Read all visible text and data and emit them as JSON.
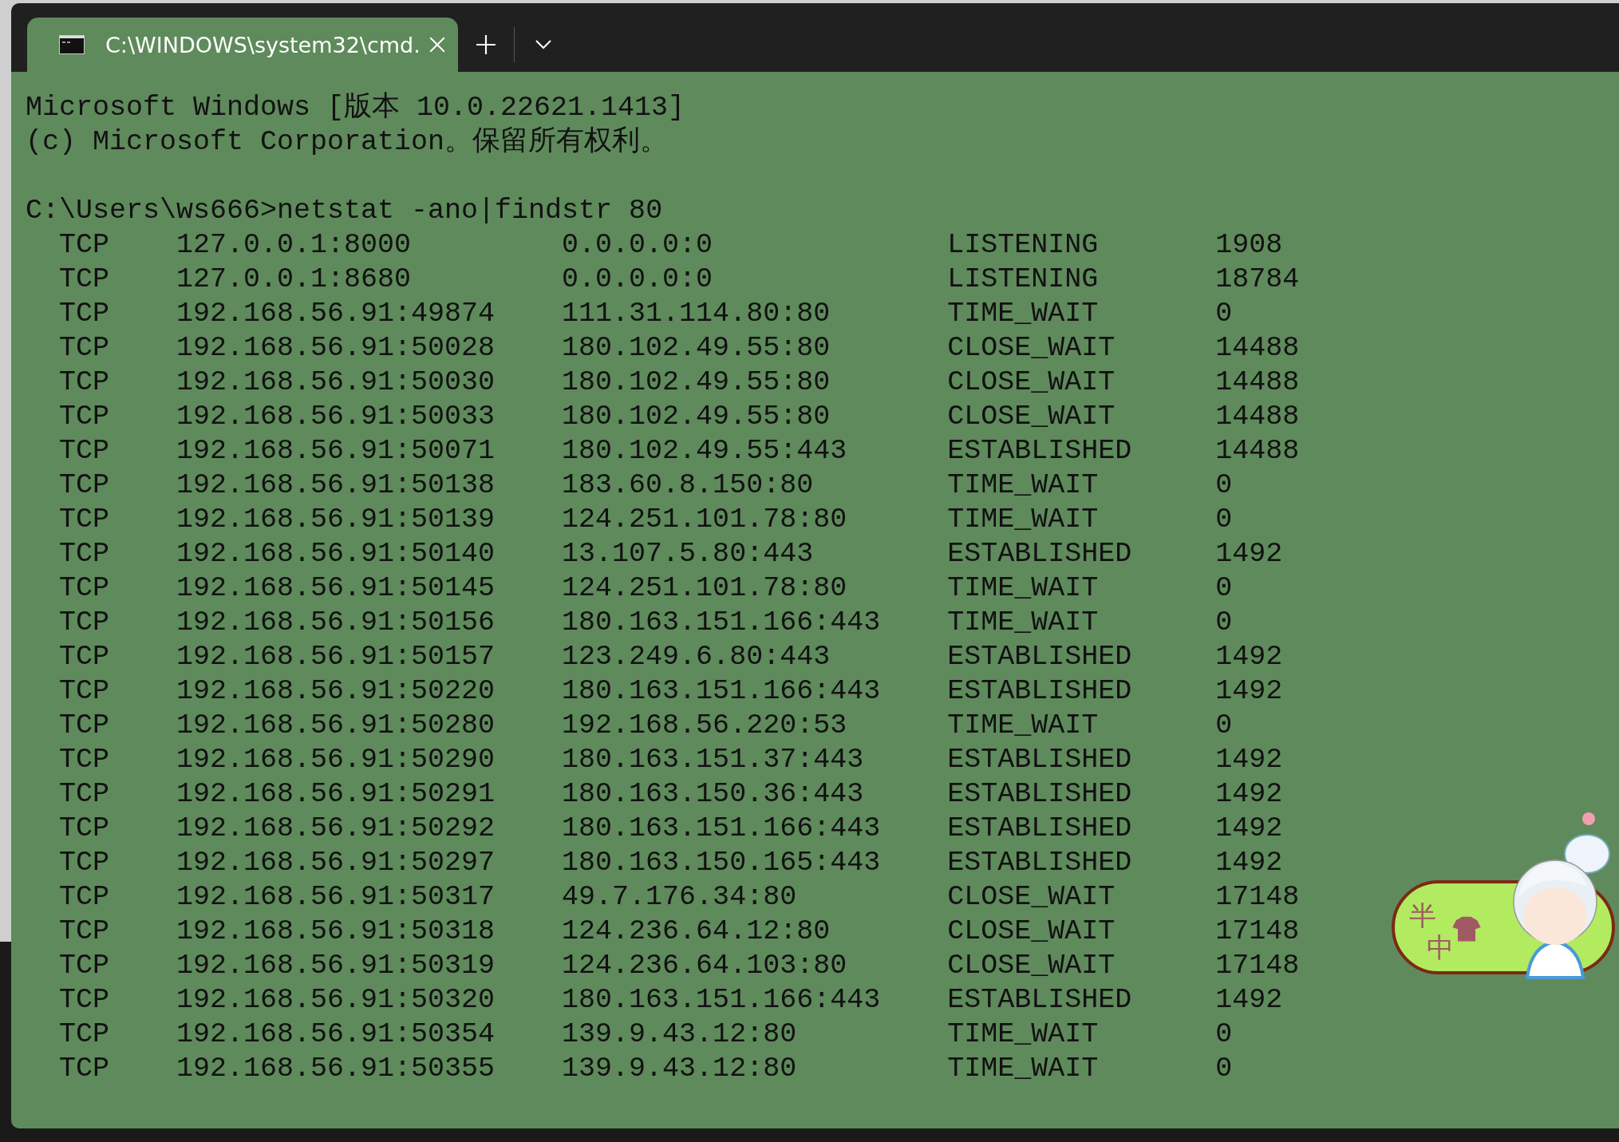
{
  "window": {
    "tab": {
      "title": "C:\\WINDOWS\\system32\\cmd.",
      "selected": true
    }
  },
  "console": {
    "header": [
      "Microsoft Windows [版本 10.0.22621.1413]",
      "(c) Microsoft Corporation。保留所有权利。"
    ],
    "prompt": "C:\\Users\\ws666>netstat -ano|findstr 80",
    "rows": [
      {
        "proto": "TCP",
        "local": "127.0.0.1:8000",
        "foreign": "0.0.0.0:0",
        "state": "LISTENING",
        "pid": "1908"
      },
      {
        "proto": "TCP",
        "local": "127.0.0.1:8680",
        "foreign": "0.0.0.0:0",
        "state": "LISTENING",
        "pid": "18784"
      },
      {
        "proto": "TCP",
        "local": "192.168.56.91:49874",
        "foreign": "111.31.114.80:80",
        "state": "TIME_WAIT",
        "pid": "0"
      },
      {
        "proto": "TCP",
        "local": "192.168.56.91:50028",
        "foreign": "180.102.49.55:80",
        "state": "CLOSE_WAIT",
        "pid": "14488"
      },
      {
        "proto": "TCP",
        "local": "192.168.56.91:50030",
        "foreign": "180.102.49.55:80",
        "state": "CLOSE_WAIT",
        "pid": "14488"
      },
      {
        "proto": "TCP",
        "local": "192.168.56.91:50033",
        "foreign": "180.102.49.55:80",
        "state": "CLOSE_WAIT",
        "pid": "14488"
      },
      {
        "proto": "TCP",
        "local": "192.168.56.91:50071",
        "foreign": "180.102.49.55:443",
        "state": "ESTABLISHED",
        "pid": "14488"
      },
      {
        "proto": "TCP",
        "local": "192.168.56.91:50138",
        "foreign": "183.60.8.150:80",
        "state": "TIME_WAIT",
        "pid": "0"
      },
      {
        "proto": "TCP",
        "local": "192.168.56.91:50139",
        "foreign": "124.251.101.78:80",
        "state": "TIME_WAIT",
        "pid": "0"
      },
      {
        "proto": "TCP",
        "local": "192.168.56.91:50140",
        "foreign": "13.107.5.80:443",
        "state": "ESTABLISHED",
        "pid": "1492"
      },
      {
        "proto": "TCP",
        "local": "192.168.56.91:50145",
        "foreign": "124.251.101.78:80",
        "state": "TIME_WAIT",
        "pid": "0"
      },
      {
        "proto": "TCP",
        "local": "192.168.56.91:50156",
        "foreign": "180.163.151.166:443",
        "state": "TIME_WAIT",
        "pid": "0"
      },
      {
        "proto": "TCP",
        "local": "192.168.56.91:50157",
        "foreign": "123.249.6.80:443",
        "state": "ESTABLISHED",
        "pid": "1492"
      },
      {
        "proto": "TCP",
        "local": "192.168.56.91:50220",
        "foreign": "180.163.151.166:443",
        "state": "ESTABLISHED",
        "pid": "1492"
      },
      {
        "proto": "TCP",
        "local": "192.168.56.91:50280",
        "foreign": "192.168.56.220:53",
        "state": "TIME_WAIT",
        "pid": "0"
      },
      {
        "proto": "TCP",
        "local": "192.168.56.91:50290",
        "foreign": "180.163.151.37:443",
        "state": "ESTABLISHED",
        "pid": "1492"
      },
      {
        "proto": "TCP",
        "local": "192.168.56.91:50291",
        "foreign": "180.163.150.36:443",
        "state": "ESTABLISHED",
        "pid": "1492"
      },
      {
        "proto": "TCP",
        "local": "192.168.56.91:50292",
        "foreign": "180.163.151.166:443",
        "state": "ESTABLISHED",
        "pid": "1492"
      },
      {
        "proto": "TCP",
        "local": "192.168.56.91:50297",
        "foreign": "180.163.150.165:443",
        "state": "ESTABLISHED",
        "pid": "1492"
      },
      {
        "proto": "TCP",
        "local": "192.168.56.91:50317",
        "foreign": "49.7.176.34:80",
        "state": "CLOSE_WAIT",
        "pid": "17148"
      },
      {
        "proto": "TCP",
        "local": "192.168.56.91:50318",
        "foreign": "124.236.64.12:80",
        "state": "CLOSE_WAIT",
        "pid": "17148"
      },
      {
        "proto": "TCP",
        "local": "192.168.56.91:50319",
        "foreign": "124.236.64.103:80",
        "state": "CLOSE_WAIT",
        "pid": "17148"
      },
      {
        "proto": "TCP",
        "local": "192.168.56.91:50320",
        "foreign": "180.163.151.166:443",
        "state": "ESTABLISHED",
        "pid": "1492"
      },
      {
        "proto": "TCP",
        "local": "192.168.56.91:50354",
        "foreign": "139.9.43.12:80",
        "state": "TIME_WAIT",
        "pid": "0"
      },
      {
        "proto": "TCP",
        "local": "192.168.56.91:50355",
        "foreign": "139.9.43.12:80",
        "state": "TIME_WAIT",
        "pid": "0"
      }
    ]
  },
  "widget": {
    "chars": [
      "半",
      "中"
    ]
  }
}
